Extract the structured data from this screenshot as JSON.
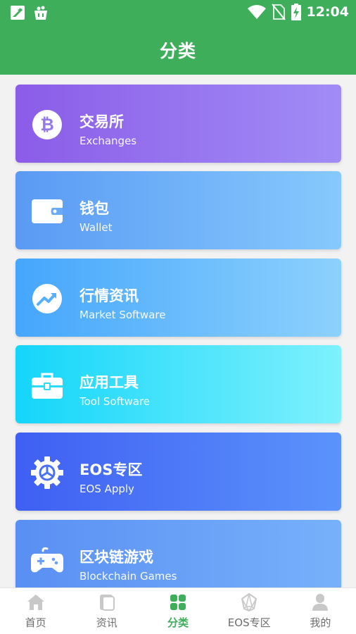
{
  "status_bar": {
    "time": "12:04"
  },
  "app_bar": {
    "title": "分类"
  },
  "categories": [
    {
      "title": "交易所",
      "subtitle": "Exchanges",
      "icon": "bitcoin-icon"
    },
    {
      "title": "钱包",
      "subtitle": "Wallet",
      "icon": "wallet-icon"
    },
    {
      "title": "行情资讯",
      "subtitle": "Market Software",
      "icon": "trend-chart-icon"
    },
    {
      "title": "应用工具",
      "subtitle": "Tool Software",
      "icon": "toolbox-icon"
    },
    {
      "title": "EOS专区",
      "subtitle": "EOS Apply",
      "icon": "eos-gear-icon"
    },
    {
      "title": "区块链游戏",
      "subtitle": "Blockchain Games",
      "icon": "gamepad-icon"
    }
  ],
  "tab_bar": {
    "active_index": 2,
    "items": [
      {
        "label": "首页",
        "icon": "home-icon"
      },
      {
        "label": "资讯",
        "icon": "news-icon"
      },
      {
        "label": "分类",
        "icon": "category-grid-icon"
      },
      {
        "label": "EOS专区",
        "icon": "eos-diamond-icon"
      },
      {
        "label": "我的",
        "icon": "profile-icon"
      }
    ]
  },
  "colors": {
    "primary": "#3fae5b",
    "tab_inactive": "#6d6d6d"
  }
}
